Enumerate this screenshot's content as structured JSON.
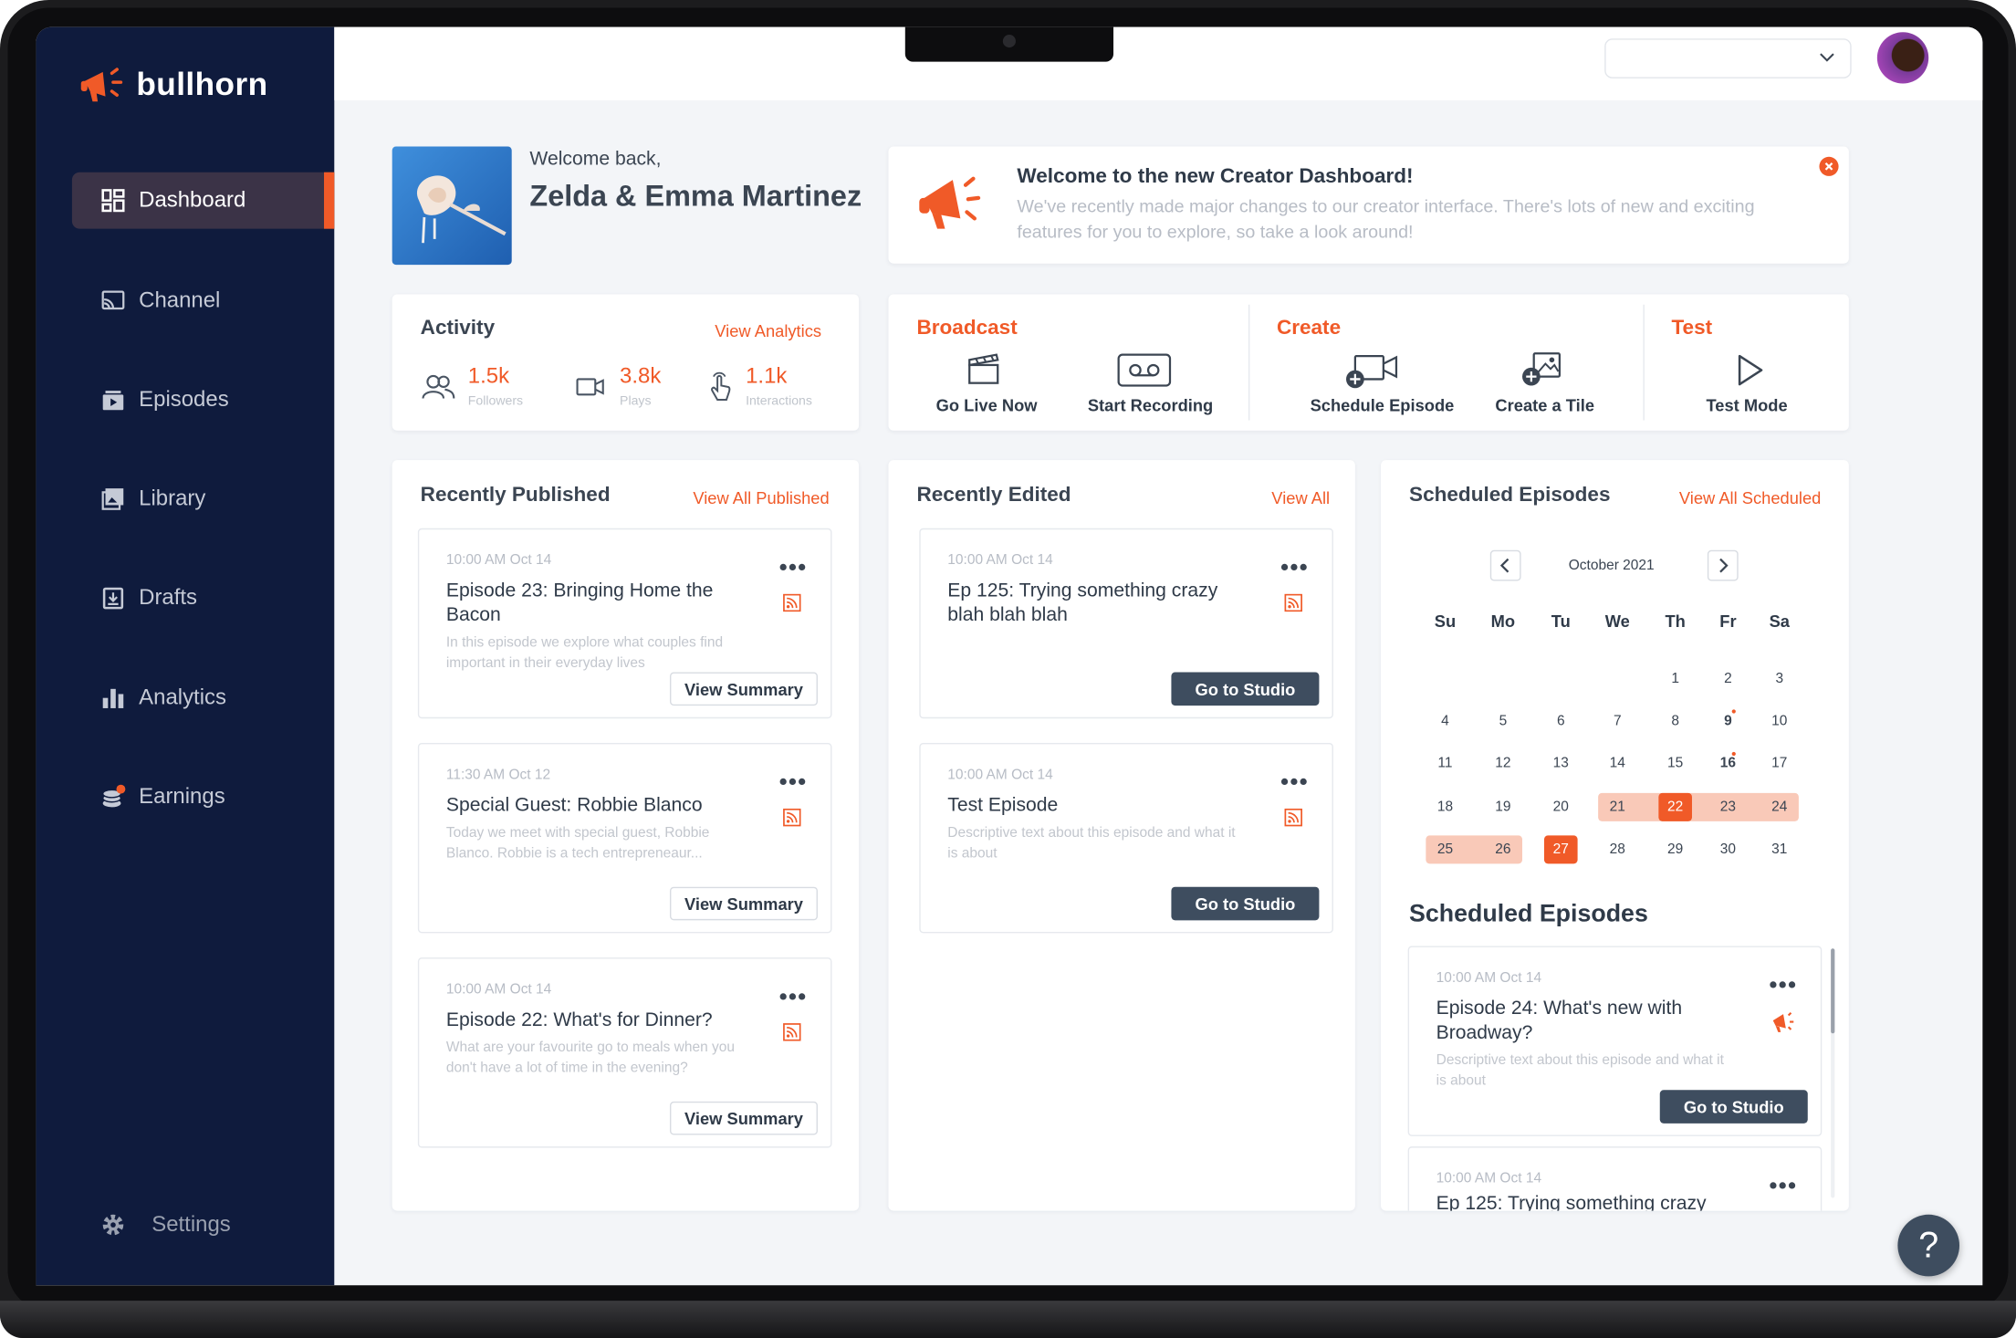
{
  "app": {
    "name": "bullhorn"
  },
  "sidebar": {
    "items": [
      {
        "label": "Dashboard",
        "icon": "dashboard-icon"
      },
      {
        "label": "Channel",
        "icon": "cast-icon"
      },
      {
        "label": "Episodes",
        "icon": "episodes-icon"
      },
      {
        "label": "Library",
        "icon": "image-icon"
      },
      {
        "label": "Drafts",
        "icon": "drafts-icon"
      },
      {
        "label": "Analytics",
        "icon": "bar-chart-icon"
      },
      {
        "label": "Earnings",
        "icon": "coins-icon"
      }
    ],
    "settings_label": "Settings"
  },
  "welcome": {
    "greeting": "Welcome back,",
    "name": "Zelda & Emma Martinez"
  },
  "banner": {
    "title": "Welcome to the new Creator Dashboard!",
    "text": "We've recently made major changes to our creator interface. There's lots of new and exciting features for you to explore, so take a look around!"
  },
  "activity": {
    "title": "Activity",
    "link": "View Analytics",
    "stats": [
      {
        "value": "1.5k",
        "label": "Followers"
      },
      {
        "value": "3.8k",
        "label": "Plays"
      },
      {
        "value": "1.1k",
        "label": "Interactions"
      }
    ]
  },
  "tools": {
    "broadcast": {
      "title": "Broadcast",
      "items": [
        "Go Live Now",
        "Start Recording"
      ]
    },
    "create": {
      "title": "Create",
      "items": [
        "Schedule Episode",
        "Create a Tile"
      ]
    },
    "test": {
      "title": "Test",
      "items": [
        "Test Mode"
      ]
    }
  },
  "published": {
    "title": "Recently Published",
    "link": "View All Published",
    "button": "View Summary",
    "items": [
      {
        "time": "10:00 AM Oct 14",
        "title": "Episode 23: Bringing Home the Bacon",
        "desc": "In this episode we explore what couples find important in their everyday lives"
      },
      {
        "time": "11:30 AM Oct 12",
        "title": "Special Guest: Robbie Blanco",
        "desc": "Today we meet with special guest, Robbie Blanco. Robbie is a tech entrepreneaur..."
      },
      {
        "time": "10:00 AM Oct 14",
        "title": "Episode 22: What's for Dinner?",
        "desc": "What are your favourite go to meals when you don't have a lot of time in the evening?"
      }
    ]
  },
  "edited": {
    "title": "Recently Edited",
    "link": "View All",
    "button": "Go to Studio",
    "items": [
      {
        "time": "10:00 AM Oct 14",
        "title": "Ep 125: Trying something crazy blah blah blah",
        "desc": ""
      },
      {
        "time": "10:00 AM Oct 14",
        "title": "Test Episode",
        "desc": "Descriptive text about this episode and what it is about"
      }
    ]
  },
  "scheduled": {
    "title": "Scheduled Episodes",
    "link": "View All Scheduled",
    "month": "October 2021",
    "weekdays": [
      "Su",
      "Mo",
      "Tu",
      "We",
      "Th",
      "Fr",
      "Sa"
    ],
    "days": [
      "1",
      "2",
      "3",
      "4",
      "5",
      "6",
      "7",
      "8",
      "9",
      "10",
      "11",
      "12",
      "13",
      "14",
      "15",
      "16",
      "17",
      "18",
      "19",
      "20",
      "21",
      "22",
      "23",
      "24",
      "25",
      "26",
      "27",
      "28",
      "29",
      "30",
      "31"
    ],
    "list_title": "Scheduled Episodes",
    "button": "Go to Studio",
    "items": [
      {
        "time": "10:00 AM Oct 14",
        "title": "Episode 24: What's new with Broadway?",
        "desc": "Descriptive text about this episode and what it is about"
      },
      {
        "time": "10:00 AM Oct 14",
        "title": "Ep 125: Trying something crazy"
      }
    ]
  },
  "help": {
    "label": "?"
  },
  "colors": {
    "accent": "#f05a28",
    "sidebar": "#0f1b3d",
    "dark_button": "#3e4d5f",
    "range": "#f9c9b8"
  }
}
